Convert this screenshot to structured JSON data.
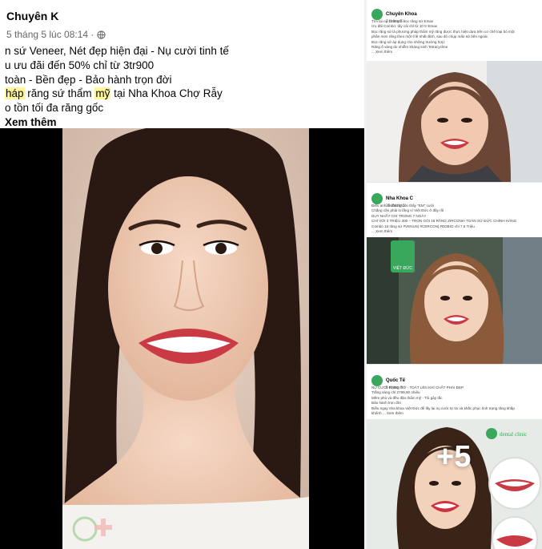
{
  "main_post": {
    "author": "Chuyên K",
    "meta": "5 tháng 5 lúc 08:14 ·",
    "lines": [
      {
        "pre": "n sứ Veneer, Nét đẹp hiện đại - Nụ cười tinh tế"
      },
      {
        "pre": "u ưu đãi đến 50% chỉ từ 3tr900"
      },
      {
        "pre": "toàn - Bền đẹp - Bảo hành trọn đời"
      },
      {
        "hl1": "háp",
        "mid": " răng sứ thẩm ",
        "hl2": "mỹ",
        "post": " tại Nha Khoa Chợ Rẫy"
      },
      {
        "pre": "o tồn tối đa răng gốc"
      }
    ],
    "see_more": "Xem thêm"
  },
  "side_posts": [
    {
      "name": "Chuyên Khoa",
      "time": "2 tháng 5 ·",
      "lines": [
        "Tìm lại nụ cười với bọc răng sứ Emax",
        "Ưu đãi Combo: tẩy cái chỉ từ 10 tr Emax",
        "Bọc răng sứ là phương pháp thẩm mỹ răng được thực hiện dựa trên cơ chế loại bỏ một",
        "phần men răng theo một tỉ lệ nhất định, sau đó chụp mão sứ bên ngoài.",
        "Bọc răng sứ áp dụng cho những trường hợp:",
        "Răng ố vàng do nhiễm kháng sinh Tetracycline",
        "... Xem thêm"
      ]
    },
    {
      "name": "Nha Khoa C",
      "time": "29 tháng 5 ·",
      "lines": [
        "Điều anh muốn là luôn thấy \"EM\" cười",
        "Chẳng cần phải lo lắng vì Việt Đức ở đây rồi",
        "DUY NHẤT CHỈ TRONG 7 NGÀY",
        "CHỈ VỚI 3 TRIỆU 300 – TRỌN GÓI 16 RĂNG ZIRCONIA TOÀN SỨ ĐỨC CHÍNH HÃNG",
        "Combo 16 răng sứ #VENUS| #CERCON| #DDBIO chỉ 7,5 Triệu",
        "... Xem thêm"
      ]
    },
    {
      "name": "Quốc Tế",
      "time": "5 tháng 5 ·",
      "lines": [
        "NỤ CƯỜI RẠNG RỠ - TOÁT LÊN KHÍ CHẤT PHÁI ĐẸP",
        "Trắng sáng chỉ 2799,90 nhiêu",
        "Mềm phù và đều đặn thẩm mỹ - Tôi gây tắc",
        "Bảo hành trọn đời",
        "Điều ngay nha khoa Việt Đức để lấy lại nụ cười tự tin và khắc phục tình trạng răng khấp",
        "khểnh ... Xem thêm"
      ],
      "badge": "dental clinic",
      "more_count": "+5"
    }
  ],
  "logo_text": "VIỆT ĐỨC",
  "colors": {
    "highlight": "#fff59b",
    "brand_green": "#3aa85c",
    "lip": "#c93a44"
  }
}
